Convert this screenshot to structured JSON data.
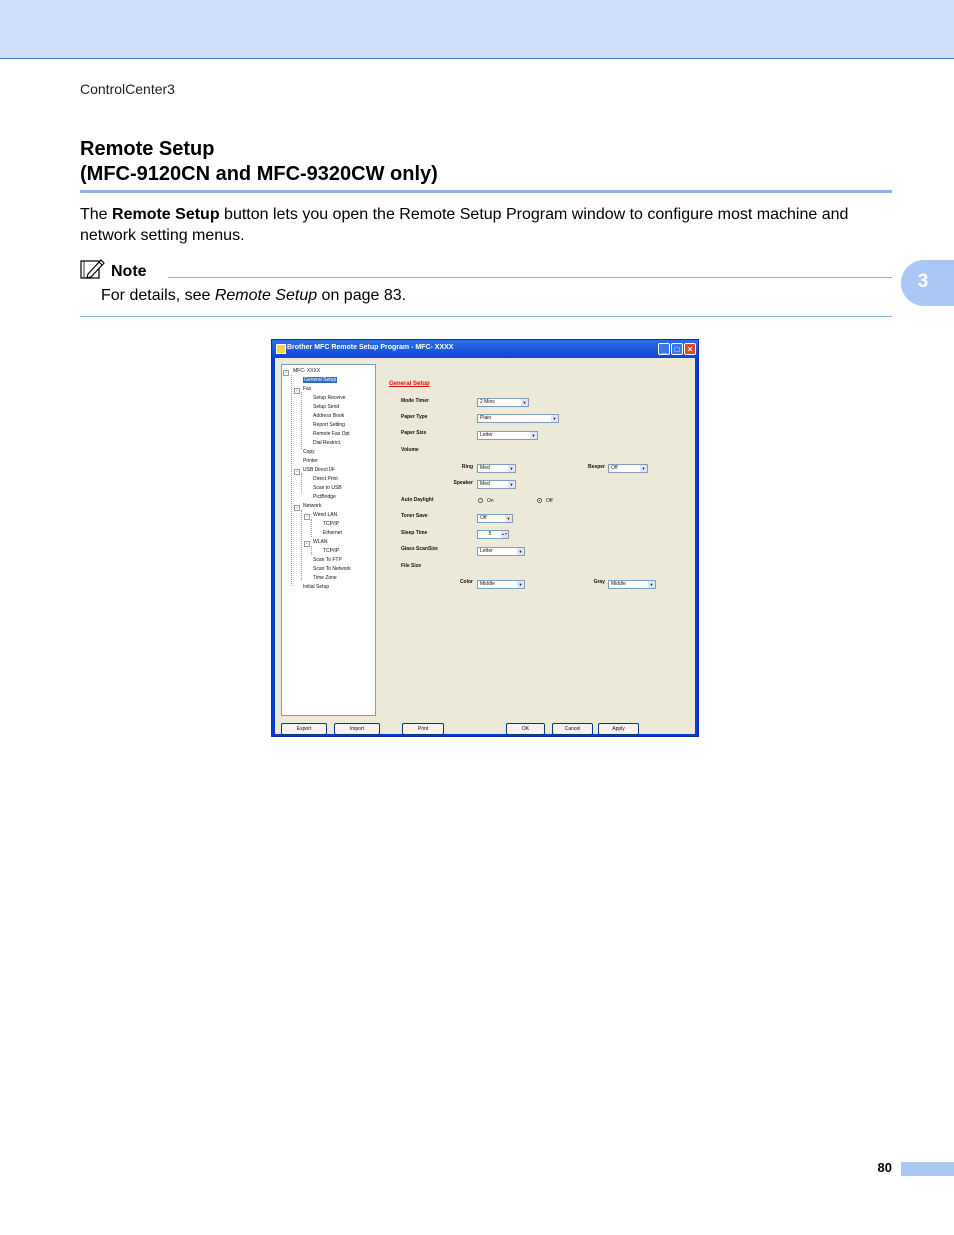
{
  "header": {
    "running_head": "ControlCenter3"
  },
  "title": {
    "line1": "Remote Setup",
    "line2": "(MFC-9120CN and MFC-9320CW only)"
  },
  "intro": {
    "before": "The ",
    "bold": "Remote Setup",
    "after": " button lets you open the Remote Setup Program window to configure most machine and network setting menus."
  },
  "note": {
    "label": "Note",
    "before": "For details, see ",
    "italic": "Remote Setup",
    "after": " on page 83."
  },
  "chapter_tab": "3",
  "page_number": "80",
  "colors": {
    "accent": "#8db1ec",
    "topbar": "#cfe0fb",
    "titlebar": "#0a46d3",
    "section_title": "#e01010"
  },
  "window": {
    "title": "Brother MFC Remote Setup Program - MFC- XXXX",
    "controls": {
      "minimize": "_",
      "maximize": "□",
      "close": "✕"
    },
    "tree": {
      "root": "MFC- XXXX",
      "general_setup": "General Setup",
      "fax": "Fax",
      "setup_receive": "Setup Receive",
      "setup_send": "Setup Send",
      "address_book": "Address Book",
      "report_setting": "Report Setting",
      "remote_fax_opt": "Remote Fax Opt",
      "dial_restrict": "Dial Restrict.",
      "copy": "Copy",
      "printer": "Printer",
      "usb_direct": "USB Direct I/F",
      "direct_print": "Direct Print",
      "scan_to_usb": "Scan to USB",
      "pictbridge": "PictBridge",
      "network": "Network",
      "wired_lan": "Wired LAN",
      "wired_tcpip": "TCP/IP",
      "ethernet": "Ethernet",
      "wlan": "WLAN",
      "wlan_tcpip": "TCP/IP",
      "scan_to_ftp": "Scan To FTP",
      "scan_to_network": "Scan To Network",
      "time_zone": "Time Zone",
      "initial_setup": "Initial Setup"
    },
    "section_title": "General Setup",
    "fields": {
      "mode_timer": {
        "label": "Mode Timer",
        "value": "2 Mins"
      },
      "paper_type": {
        "label": "Paper Type",
        "value": "Plain"
      },
      "paper_size": {
        "label": "Paper Size",
        "value": "Letter"
      },
      "volume": {
        "label": "Volume"
      },
      "ring": {
        "label": "Ring",
        "value": "Med"
      },
      "beeper": {
        "label": "Beeper",
        "value": "Off"
      },
      "speaker": {
        "label": "Speaker",
        "value": "Med"
      },
      "auto_daylight": {
        "label": "Auto Daylight",
        "on": "On",
        "off": "Off",
        "selected": "Off"
      },
      "toner_save": {
        "label": "Toner Save",
        "value": "Off"
      },
      "sleep_time": {
        "label": "Sleep Time",
        "value": "5"
      },
      "glass_scan_size": {
        "label": "Glass ScanSize",
        "value": "Letter"
      },
      "file_size": {
        "label": "File Size"
      },
      "color": {
        "label": "Color",
        "value": "Middle"
      },
      "gray": {
        "label": "Gray",
        "value": "Middle"
      }
    },
    "buttons": {
      "export": "Export",
      "import": "Import",
      "print": "Print",
      "ok": "OK",
      "cancel": "Cancel",
      "apply": "Apply"
    },
    "icons": {
      "combo_arrow": "▼",
      "spin": "▲▼"
    }
  }
}
